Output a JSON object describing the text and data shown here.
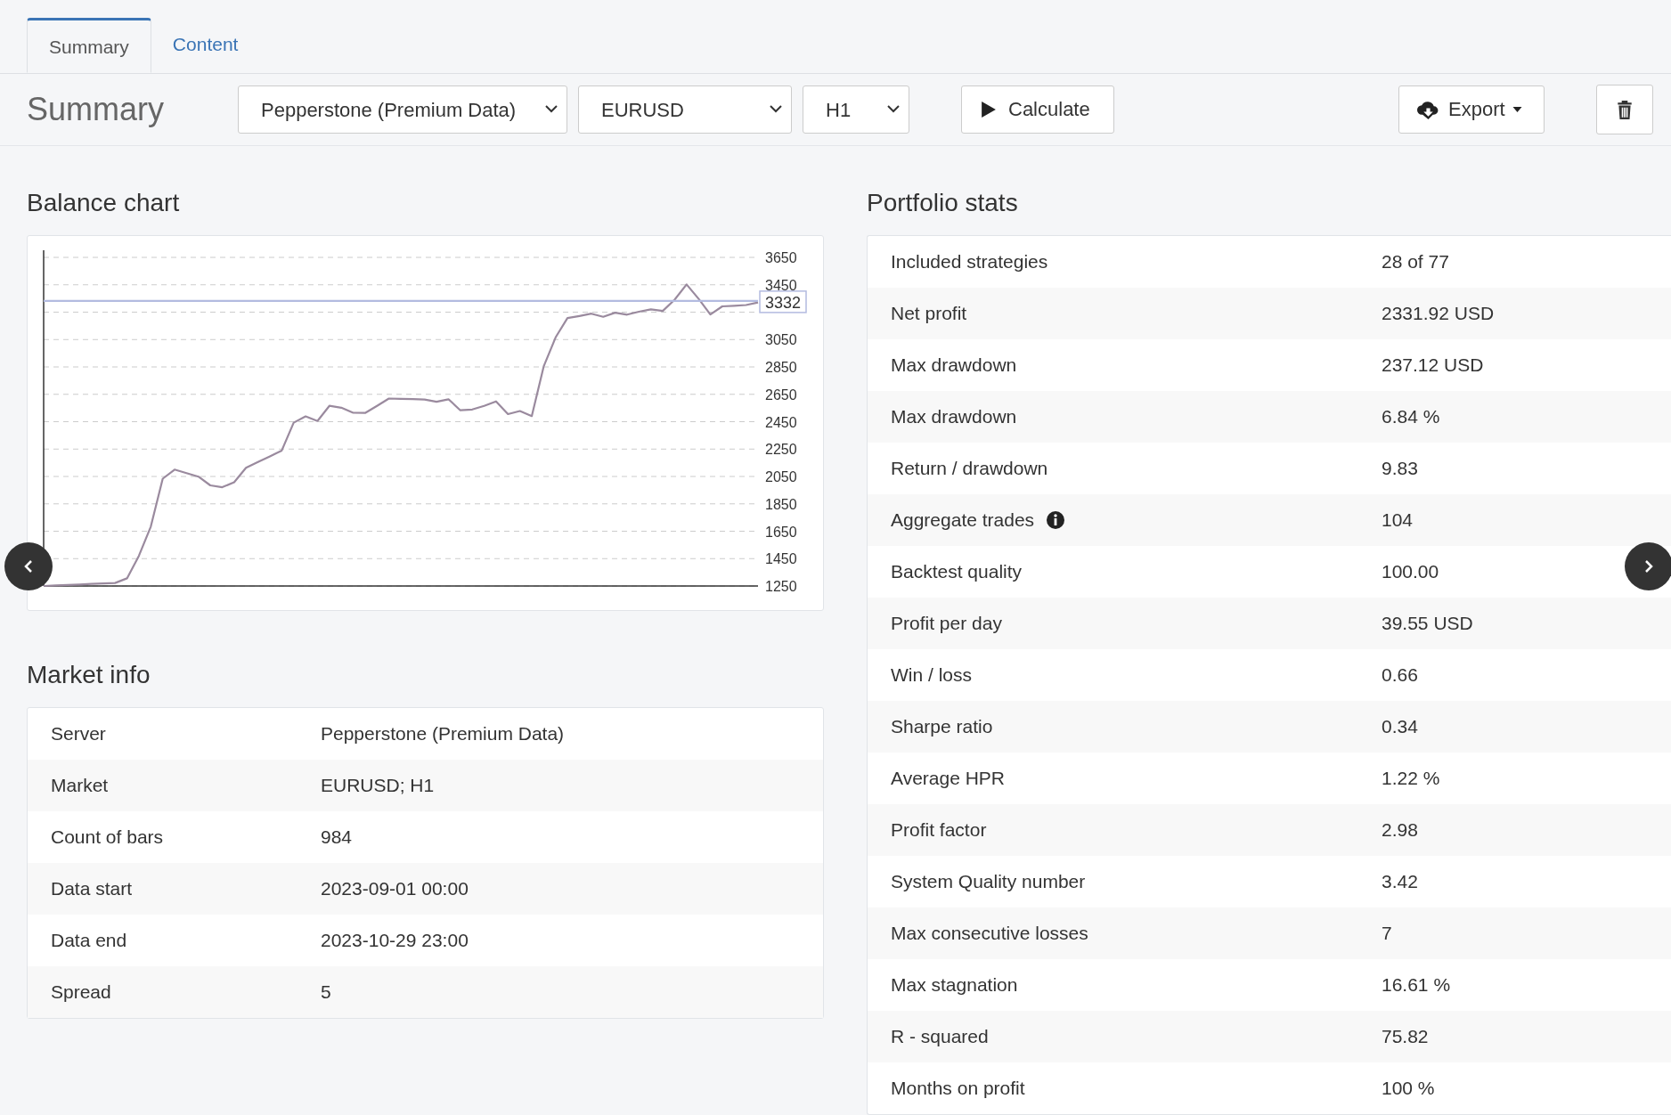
{
  "tabs": [
    {
      "label": "Summary",
      "selected": true
    },
    {
      "label": "Content",
      "selected": false
    }
  ],
  "toolbar": {
    "title": "Summary",
    "server_select": "Pepperstone (Premium Data)",
    "symbol_select": "EURUSD",
    "period_select": "H1",
    "calculate_button": "Calculate",
    "export_button": "Export"
  },
  "balance_chart": {
    "title": "Balance chart",
    "chart_data": {
      "type": "line",
      "grid": true,
      "ylim": [
        1250,
        3650
      ],
      "yticks": [
        1250,
        1450,
        1650,
        1850,
        2050,
        2250,
        2450,
        2650,
        2850,
        3050,
        3450,
        3650
      ],
      "series": [
        {
          "color": "#9a8a9e",
          "values": [
            1250,
            1254,
            1257,
            1261,
            1265,
            1268,
            1272,
            1306,
            1470,
            1684,
            2034,
            2100,
            2075,
            2049,
            1985,
            1971,
            2008,
            2114,
            2156,
            2197,
            2239,
            2443,
            2489,
            2455,
            2566,
            2552,
            2515,
            2514,
            2566,
            2619,
            2617,
            2615,
            2612,
            2595,
            2614,
            2533,
            2539,
            2566,
            2598,
            2505,
            2528,
            2491,
            2854,
            3066,
            3207,
            3222,
            3239,
            3216,
            3246,
            3232,
            3253,
            3271,
            3259,
            3341,
            3452,
            3348,
            3233,
            3292,
            3297,
            3302,
            3321
          ]
        },
        {
          "color": "#b3bbe0",
          "values": [
            3332,
            3332,
            3332,
            3332,
            3332,
            3332,
            3332,
            3332,
            3332,
            3332,
            3332,
            3332,
            3332,
            3332,
            3332,
            3332,
            3332,
            3332,
            3332,
            3332,
            3332,
            3332,
            3332,
            3332,
            3332,
            3332,
            3332,
            3332,
            3332,
            3332,
            3332,
            3332,
            3332,
            3332,
            3332,
            3332,
            3332,
            3332,
            3332,
            3332,
            3332,
            3332,
            3332,
            3332,
            3332,
            3332,
            3332,
            3332,
            3332,
            3332,
            3332,
            3332,
            3332,
            3332,
            3332,
            3332,
            3332,
            3332,
            3332,
            3332,
            3332
          ]
        }
      ]
    },
    "value_label": "3332"
  },
  "market_info": {
    "title": "Market info",
    "rows": [
      {
        "label": "Server",
        "value": "Pepperstone (Premium Data)"
      },
      {
        "label": "Market",
        "value": "EURUSD; H1"
      },
      {
        "label": "Count of bars",
        "value": "984"
      },
      {
        "label": "Data start",
        "value": "2023-09-01 00:00"
      },
      {
        "label": "Data end",
        "value": "2023-10-29 23:00"
      },
      {
        "label": "Spread",
        "value": "5"
      }
    ]
  },
  "portfolio_stats": {
    "title": "Portfolio stats",
    "rows": [
      {
        "label": "Included strategies",
        "value": "28 of 77",
        "info": false
      },
      {
        "label": "Net profit",
        "value": "2331.92 USD",
        "info": false
      },
      {
        "label": "Max drawdown",
        "value": "237.12 USD",
        "info": false
      },
      {
        "label": "Max drawdown",
        "value": "6.84 %",
        "info": false
      },
      {
        "label": "Return / drawdown",
        "value": "9.83",
        "info": false
      },
      {
        "label": "Aggregate trades",
        "value": "104",
        "info": true
      },
      {
        "label": "Backtest quality",
        "value": "100.00",
        "info": false
      },
      {
        "label": "Profit per day",
        "value": "39.55 USD",
        "info": false
      },
      {
        "label": "Win / loss",
        "value": "0.66",
        "info": false
      },
      {
        "label": "Sharpe ratio",
        "value": "0.34",
        "info": false
      },
      {
        "label": "Average HPR",
        "value": "1.22 %",
        "info": false
      },
      {
        "label": "Profit factor",
        "value": "2.98",
        "info": false
      },
      {
        "label": "System Quality number",
        "value": "3.42",
        "info": false
      },
      {
        "label": "Max consecutive losses",
        "value": "7",
        "info": false
      },
      {
        "label": "Max stagnation",
        "value": "16.61 %",
        "info": false
      },
      {
        "label": "R - squared",
        "value": "75.82",
        "info": false
      },
      {
        "label": "Months on profit",
        "value": "100 %",
        "info": false
      }
    ]
  }
}
